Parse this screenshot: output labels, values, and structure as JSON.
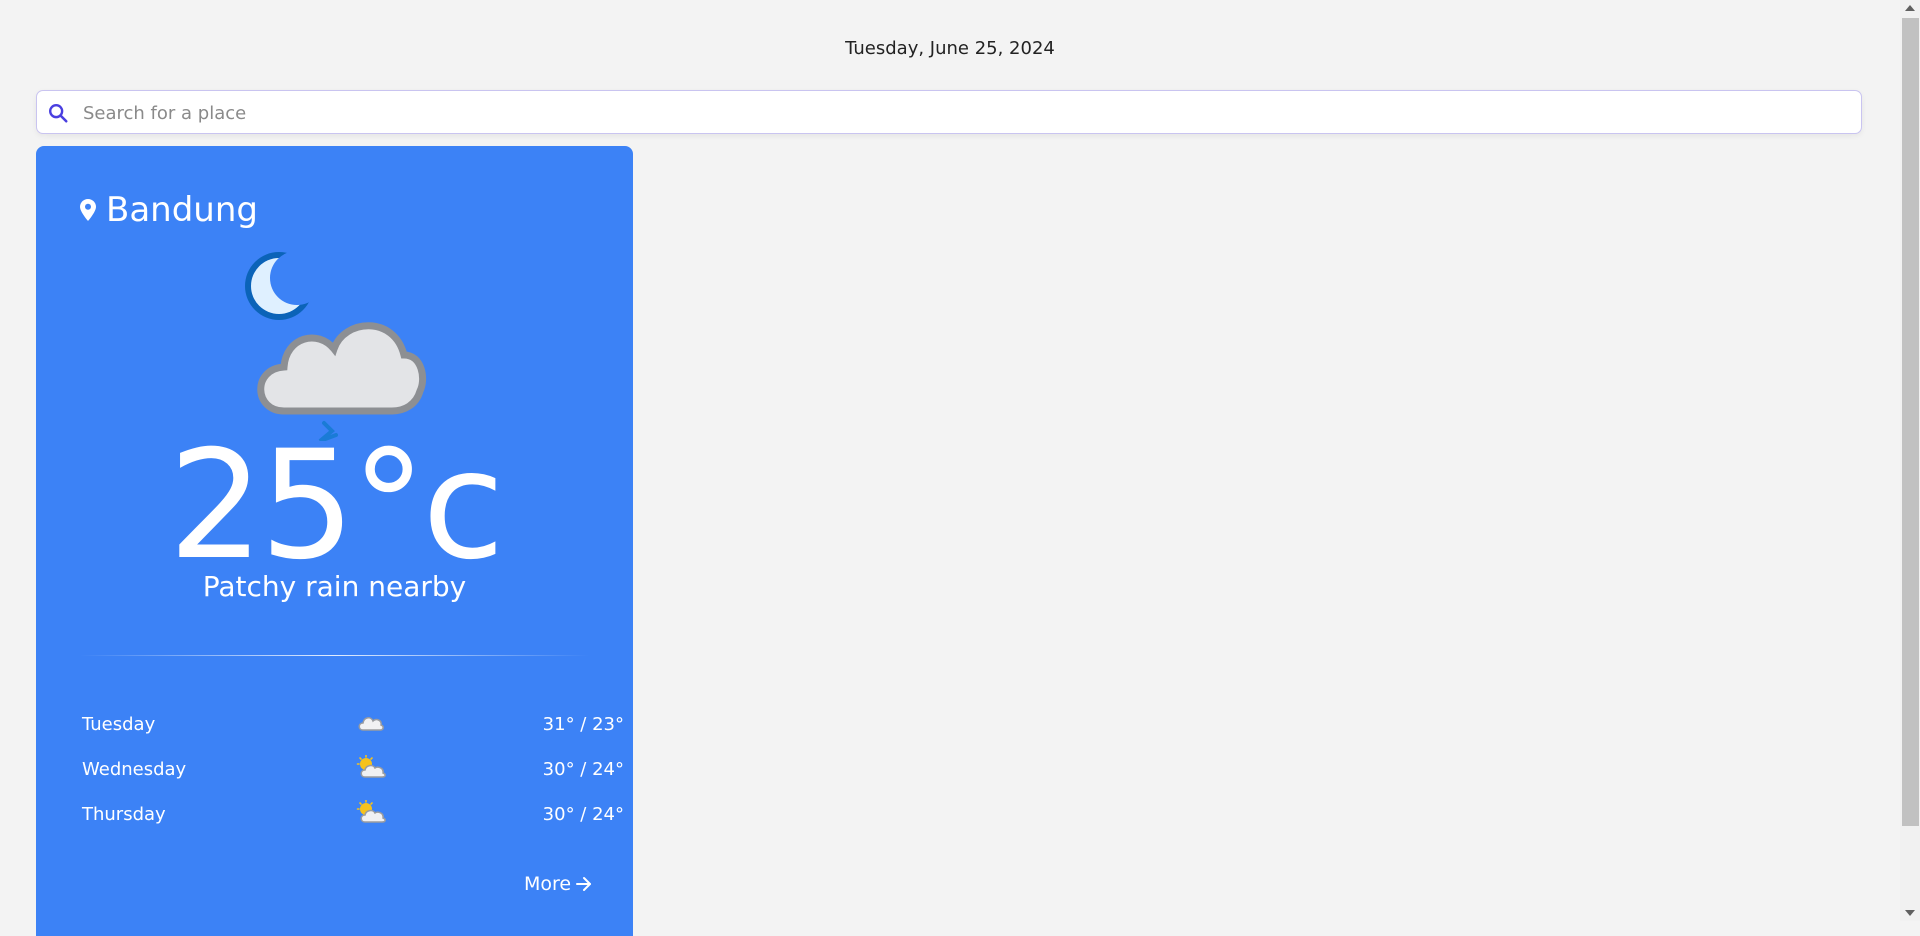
{
  "header": {
    "date": "Tuesday, June 25, 2024"
  },
  "search": {
    "placeholder": "Search for a place",
    "value": "",
    "icon": "search-icon"
  },
  "current": {
    "location": "Bandung",
    "location_icon": "map-pin-icon",
    "condition_icon": "night-cloud-rain-icon",
    "temperature": "25°c",
    "condition": "Patchy rain nearby"
  },
  "forecast": [
    {
      "day": "Tuesday",
      "icon": "cloud-icon",
      "temps": "31° / 23°"
    },
    {
      "day": "Wednesday",
      "icon": "partly-cloudy-icon",
      "temps": "30° / 24°"
    },
    {
      "day": "Thursday",
      "icon": "partly-cloudy-icon",
      "temps": "30° / 24°"
    }
  ],
  "more": {
    "label": "More",
    "icon": "arrow-right-icon"
  },
  "colors": {
    "card": "#3c82f6",
    "background": "#f3f3f3",
    "search_icon": "#4a3fe0"
  }
}
